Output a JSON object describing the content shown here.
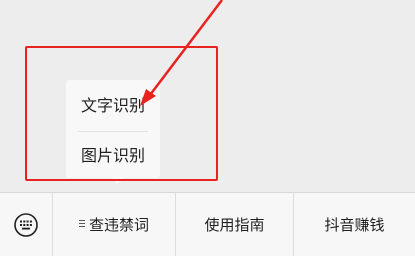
{
  "popup_menu": {
    "items": [
      {
        "label": "文字识别"
      },
      {
        "label": "图片识别"
      }
    ]
  },
  "bottom_bar": {
    "keyboard_icon": "keyboard-icon",
    "menus": [
      {
        "label": "查违禁词",
        "icon": "list-icon"
      },
      {
        "label": "使用指南"
      },
      {
        "label": "抖音赚钱"
      }
    ]
  },
  "annotation": {
    "box_color": "#e8231f",
    "arrow_color": "#e8231f"
  }
}
